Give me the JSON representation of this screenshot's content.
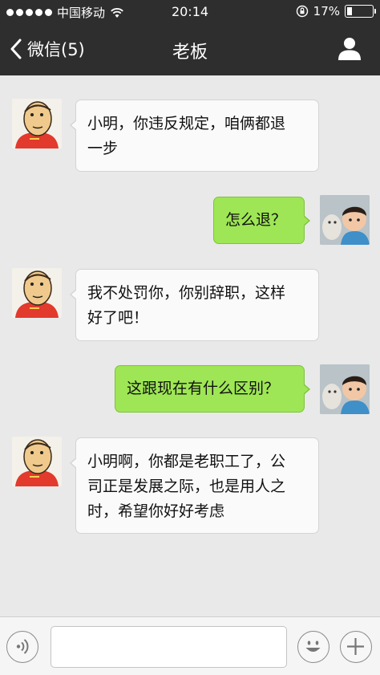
{
  "status_bar": {
    "carrier": "中国移动",
    "time": "20:14",
    "battery_percent": "17%",
    "battery_level": 0.17
  },
  "nav": {
    "back_label": "微信(5)",
    "title": "老板",
    "icons": {
      "back": "chevron-left-icon",
      "profile": "person-icon"
    }
  },
  "messages": [
    {
      "sender": "boss",
      "direction": "in",
      "lines": [
        "小明，你违反规定，咱俩都退",
        "一步"
      ]
    },
    {
      "sender": "me",
      "direction": "out",
      "lines": [
        "怎么退？"
      ]
    },
    {
      "sender": "boss",
      "direction": "in",
      "lines": [
        "我不处罚你，你别辞职，这样",
        "好了吧！"
      ]
    },
    {
      "sender": "me",
      "direction": "out",
      "lines": [
        "这跟现在有什么区别？"
      ]
    },
    {
      "sender": "boss",
      "direction": "in",
      "lines": [
        "小明啊，你都是老职工了，公",
        "司正是发展之际，也是用人之",
        "时，希望你好好考虑"
      ]
    }
  ],
  "input_bar": {
    "text_value": "",
    "icons": {
      "voice": "voice-icon",
      "emoji": "smiley-icon",
      "more": "plus-icon"
    }
  },
  "colors": {
    "header_bg": "#2e2e2e",
    "chat_bg": "#e9e9e9",
    "incoming_bubble": "#fafafa",
    "outgoing_bubble": "#9ee655"
  }
}
